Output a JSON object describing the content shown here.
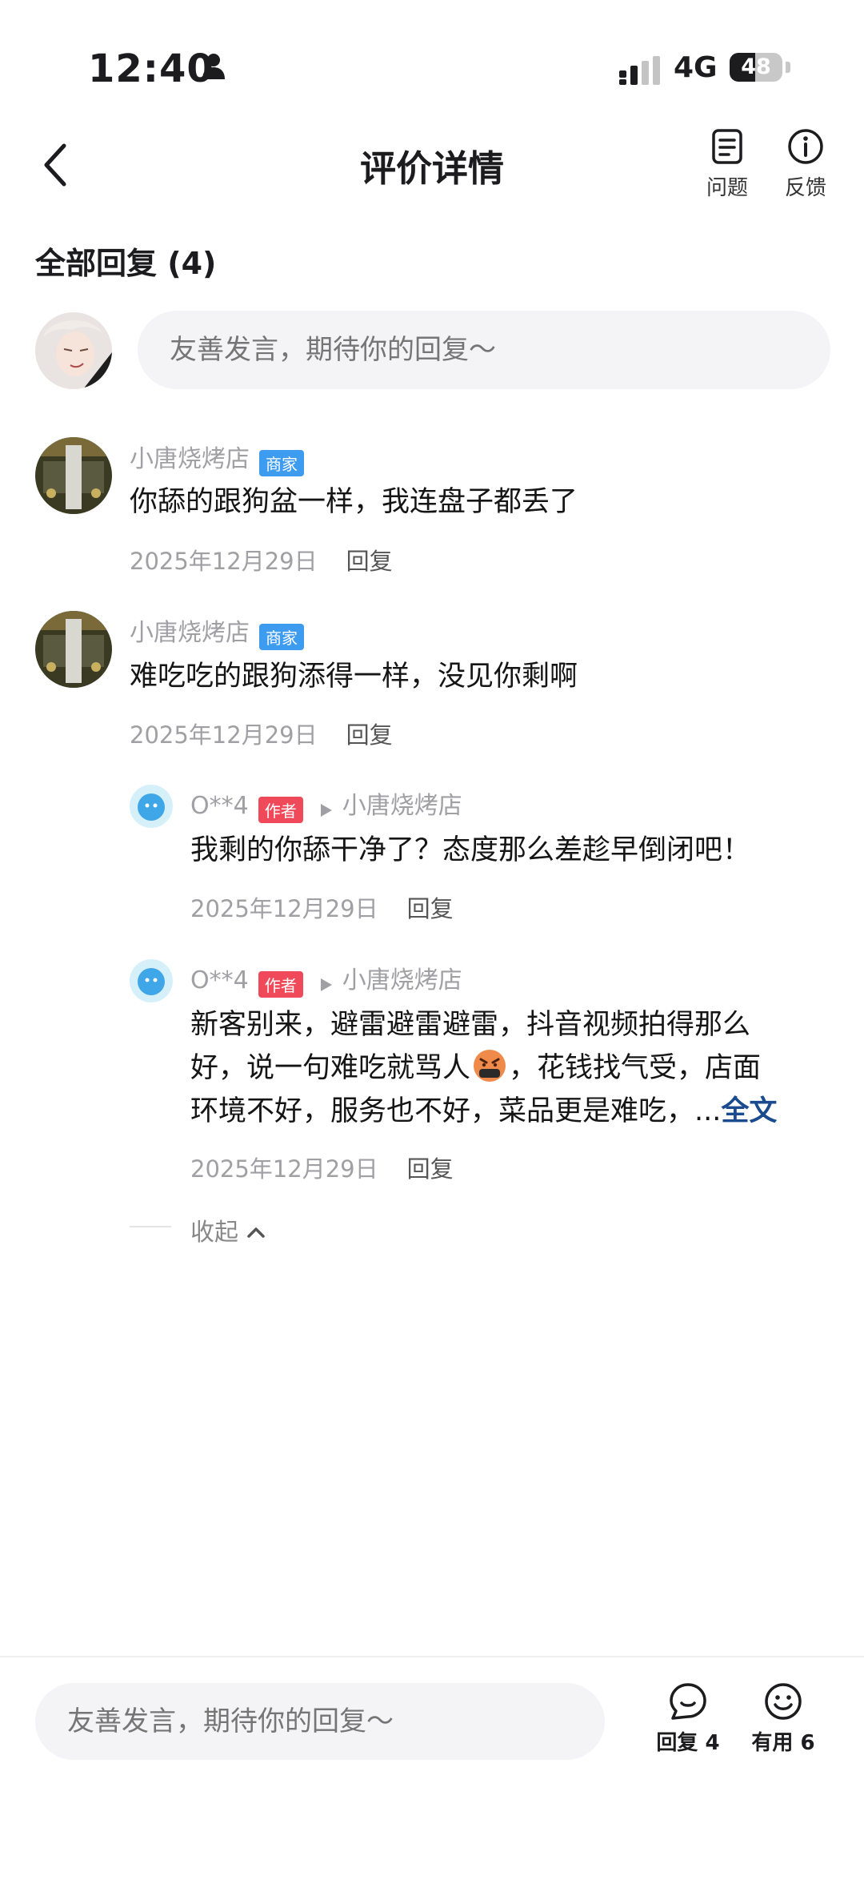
{
  "status_bar": {
    "time": "12:40",
    "network": "4G",
    "battery": "48",
    "battery_level": 0.48
  },
  "nav": {
    "title": "评价详情",
    "question_label": "问题",
    "feedback_label": "反馈"
  },
  "section": {
    "title": "全部回复 (4)"
  },
  "top_input": {
    "placeholder": "友善发言，期待你的回复～"
  },
  "comments": [
    {
      "name": "小唐烧烤店",
      "badge": "商家",
      "text": "你舔的跟狗盆一样，我连盘子都丢了",
      "date": "2025年12月29日",
      "reply_label": "回复"
    },
    {
      "name": "小唐烧烤店",
      "badge": "商家",
      "text": "难吃吃的跟狗添得一样，没见你剩啊",
      "date": "2025年12月29日",
      "reply_label": "回复"
    }
  ],
  "replies": [
    {
      "name": "O**4",
      "badge": "作者",
      "reply_to": "小唐烧烤店",
      "text": "我剩的你舔干净了？态度那么差趁早倒闭吧！",
      "date": "2025年12月29日",
      "reply_label": "回复"
    },
    {
      "name": "O**4",
      "badge": "作者",
      "reply_to": "小唐烧烤店",
      "text_line1": "新客别来，避雷避雷避雷，抖音视频拍得那么",
      "text_line2a": "好，说一句难吃就骂人",
      "text_line2b": "，花钱找气受，店面",
      "text_line3": "环境不好，服务也不好，菜品更是难吃，",
      "ellipsis": "...",
      "full_text_label": "全文",
      "date": "2025年12月29日",
      "reply_label": "回复"
    }
  ],
  "collapse_label": "收起",
  "bottom_bar": {
    "placeholder": "友善发言，期待你的回复～",
    "reply_label": "回复 4",
    "useful_label": "有用 6"
  },
  "colors": {
    "merchant_badge": "#3d9cf0",
    "author_badge": "#f04a5a",
    "link": "#1b4b8f"
  }
}
